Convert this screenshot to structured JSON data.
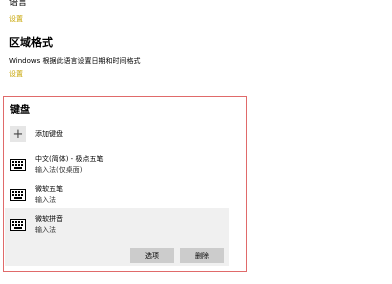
{
  "top_cut": {
    "title": "语言",
    "settings_link": "设置"
  },
  "regional": {
    "title": "区域格式",
    "description": "Windows 根据此语言设置日期和时间格式",
    "settings_link": "设置"
  },
  "keyboard": {
    "title": "键盘",
    "add_label": "添加键盘",
    "items": [
      {
        "name": "中文(简体) - 极点五笔",
        "type": "输入法(仅桌面)",
        "icon": "keyboard-icon"
      },
      {
        "name": "微软五笔",
        "type": "输入法",
        "icon": "keyboard-icon"
      },
      {
        "name": "微软拼音",
        "type": "输入法",
        "icon": "keyboard-icon"
      }
    ],
    "selected_index": 2,
    "options_button": "选项",
    "delete_button": "删除"
  },
  "colors": {
    "link": "#c7a400",
    "highlight_border": "#e06a6a",
    "selected_bg": "#f0f0f0",
    "button_bg": "#cccccc"
  }
}
